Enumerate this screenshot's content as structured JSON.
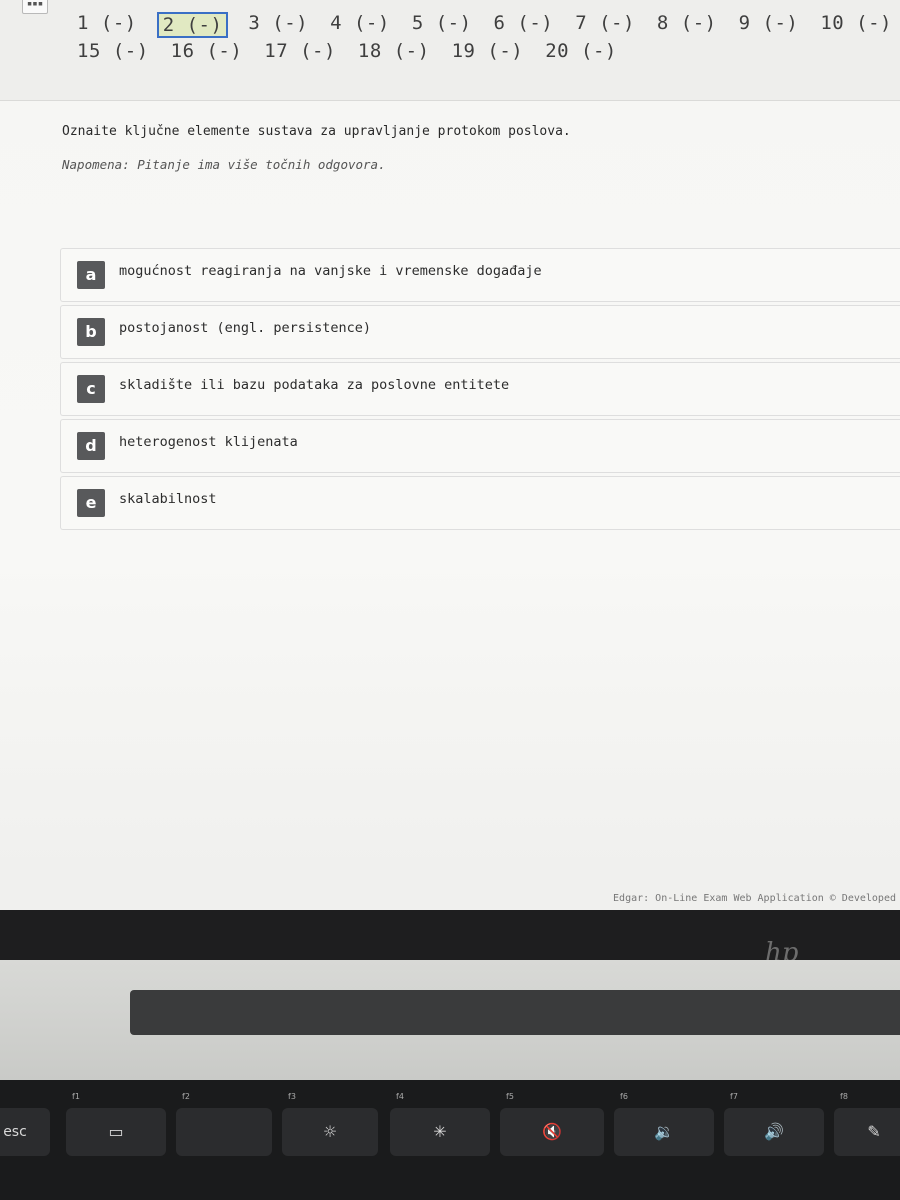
{
  "app": {
    "footer": "Edgar: On-Line Exam Web Application © Developed",
    "vendor_logo": "hp"
  },
  "nav": {
    "row1": [
      "1 (-)",
      "2 (-)",
      "3 (-)",
      "4 (-)",
      "5 (-)",
      "6 (-)",
      "7 (-)",
      "8 (-)",
      "9 (-)",
      "10 (-)"
    ],
    "row2": [
      "15 (-)",
      "16 (-)",
      "17 (-)",
      "18 (-)",
      "19 (-)",
      "20 (-)"
    ],
    "current_index": 1
  },
  "question": {
    "text": "Oznaite ključne elemente sustava za upravljanje protokom poslova.",
    "note": "Napomena: Pitanje ima više točnih odgovora."
  },
  "answers": [
    {
      "letter": "a",
      "text": "mogućnost reagiranja na vanjske i vremenske događaje"
    },
    {
      "letter": "b",
      "text": "postojanost (engl. persistence)"
    },
    {
      "letter": "c",
      "text": "skladište ili bazu podataka za poslovne entitete"
    },
    {
      "letter": "d",
      "text": "heterogenost klijenata"
    },
    {
      "letter": "e",
      "text": "skalabilnost"
    }
  ],
  "keyboard": {
    "keys": [
      "esc",
      "f1",
      "f2",
      "f3",
      "f4",
      "f5",
      "f6",
      "f7",
      "f8"
    ]
  }
}
